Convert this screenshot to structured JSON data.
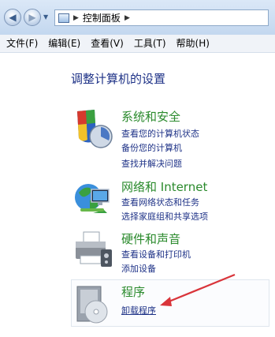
{
  "address": {
    "segments": [
      "控制面板"
    ]
  },
  "menu": [
    "文件(F)",
    "编辑(E)",
    "查看(V)",
    "工具(T)",
    "帮助(H)"
  ],
  "main": {
    "heading": "调整计算机的设置",
    "categories": [
      {
        "title": "系统和安全",
        "links": [
          "查看您的计算机状态",
          "备份您的计算机",
          "查找并解决问题"
        ]
      },
      {
        "title": "网络和 Internet",
        "links": [
          "查看网络状态和任务",
          "选择家庭组和共享选项"
        ]
      },
      {
        "title": "硬件和声音",
        "links": [
          "查看设备和打印机",
          "添加设备"
        ]
      },
      {
        "title": "程序",
        "links": [
          "卸载程序"
        ]
      }
    ]
  },
  "colors": {
    "category_title": "#2a8a2c",
    "link": "#1e3287",
    "annotation_arrow": "#d9343a"
  }
}
